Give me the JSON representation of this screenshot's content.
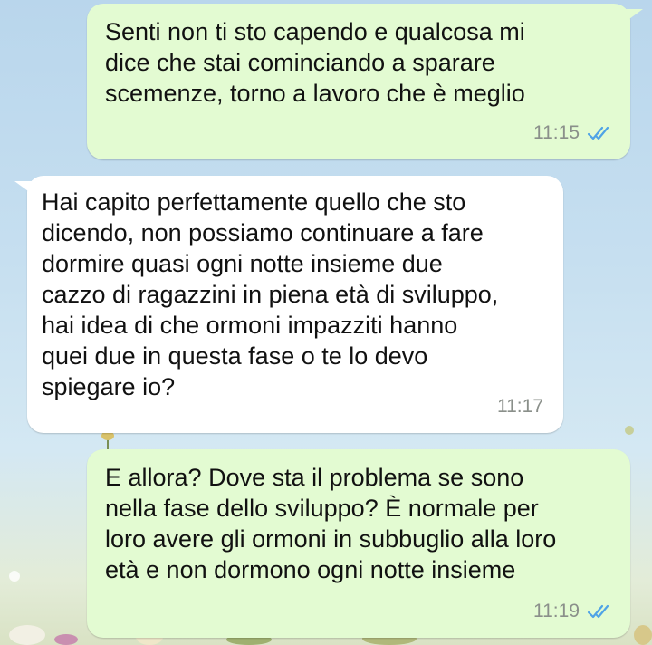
{
  "messages": [
    {
      "direction": "outgoing",
      "text": "Senti non ti sto capendo e qualcosa mi\ndice che stai cominciando a sparare\nscemenze, torno a lavoro che è meglio",
      "time": "11:15",
      "status": "read",
      "status_icon": "double-check-icon"
    },
    {
      "direction": "incoming",
      "text": "Hai capito perfettamente quello che sto\ndicendo, non possiamo continuare a fare\ndormire quasi ogni notte insieme due\ncazzo di ragazzini in piena età di sviluppo,\nhai idea di che ormoni impazziti hanno\nquei due in questa fase o te lo devo\nspiegare io?",
      "time": "11:17"
    },
    {
      "direction": "outgoing",
      "text": "E allora? Dove sta il problema se sono\nnella fase dello sviluppo? È normale per\nloro avere gli ormoni in subbuglio alla loro\netà e non dormono ogni notte insieme",
      "time": "11:19",
      "status": "read",
      "status_icon": "double-check-icon"
    }
  ],
  "colors": {
    "outgoing_bubble": "#e3fbd2",
    "incoming_bubble": "#ffffff",
    "read_ticks": "#4fa3e6",
    "timestamp": "#8a8f8a"
  }
}
